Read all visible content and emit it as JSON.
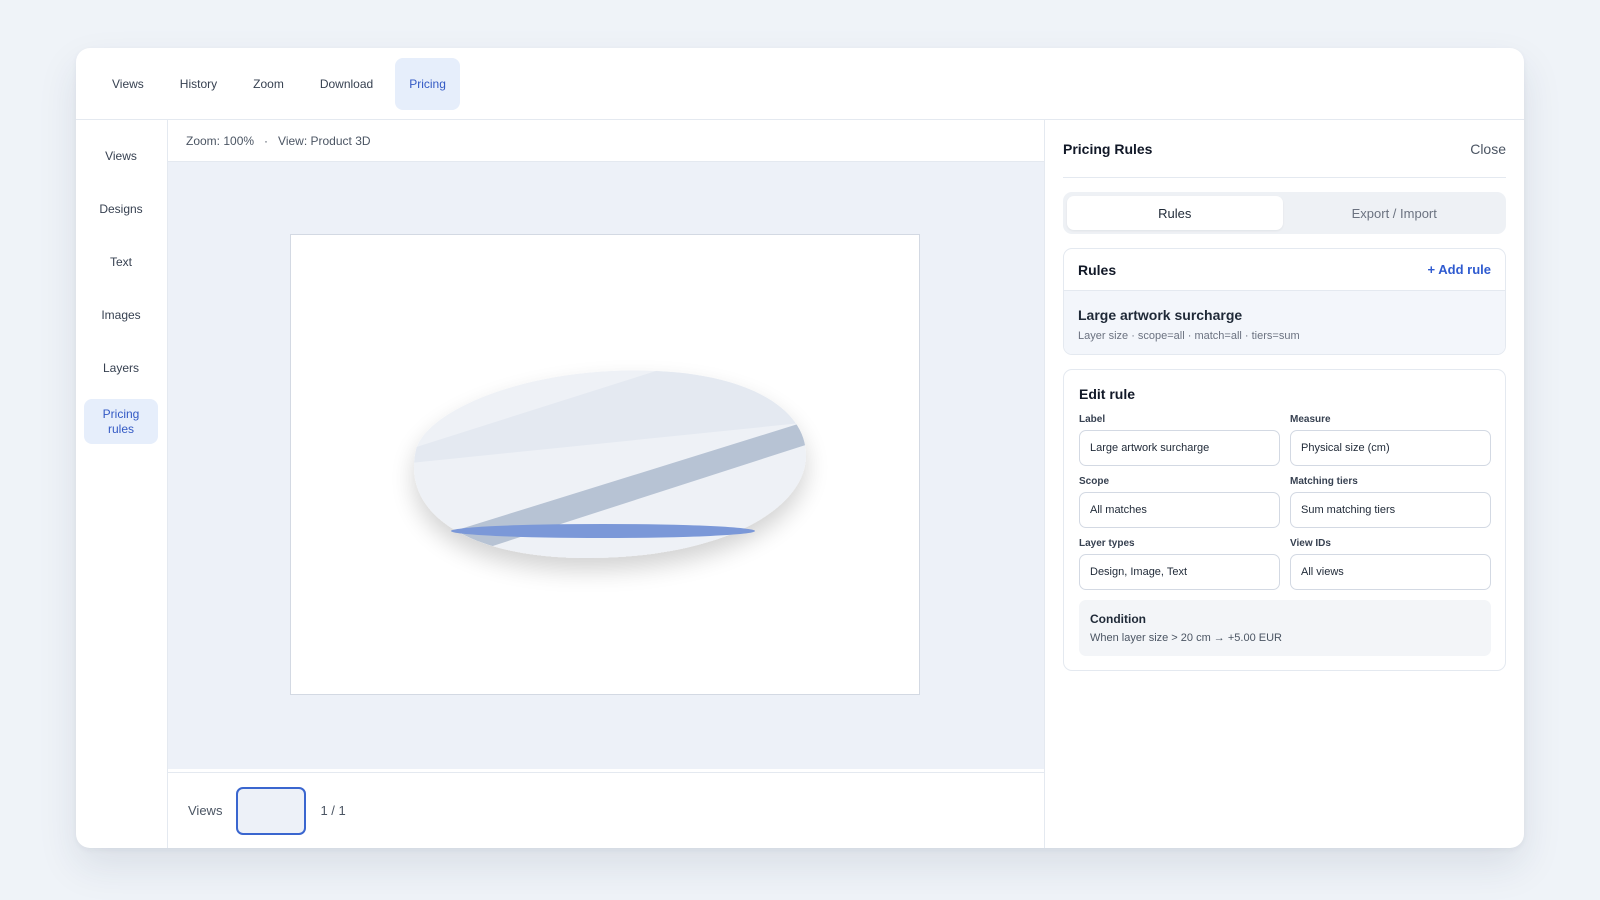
{
  "topbar": {
    "tabs": [
      {
        "label": "Views"
      },
      {
        "label": "History"
      },
      {
        "label": "Zoom"
      },
      {
        "label": "Download"
      },
      {
        "label": "Pricing"
      }
    ],
    "active_tab": "Pricing"
  },
  "sidebar": {
    "items": [
      {
        "label": "Views"
      },
      {
        "label": "Designs"
      },
      {
        "label": "Text"
      },
      {
        "label": "Images"
      },
      {
        "label": "Layers"
      },
      {
        "label": "Pricing rules"
      }
    ],
    "active_item": "Pricing rules"
  },
  "canvas": {
    "zoom_text": "Zoom: 100%",
    "separator": "·",
    "view_text": "View: Product 3D"
  },
  "bottombar": {
    "label": "Views",
    "page_count": "1 / 1"
  },
  "panel": {
    "title": "Pricing Rules",
    "close_label": "Close",
    "segments": [
      {
        "label": "Rules"
      },
      {
        "label": "Export / Import"
      }
    ],
    "active_segment": "Rules",
    "rules": {
      "header": "Rules",
      "add_label": "+ Add rule",
      "items": [
        {
          "name": "Large artwork surcharge",
          "meta": "Layer size · scope=all · match=all · tiers=sum"
        }
      ]
    },
    "edit": {
      "title": "Edit rule",
      "fields": {
        "label": {
          "label": "Label",
          "value": "Large artwork surcharge"
        },
        "measure": {
          "label": "Measure",
          "value": "Physical size (cm)"
        },
        "scope": {
          "label": "Scope",
          "value": "All matches"
        },
        "matching_tiers": {
          "label": "Matching tiers",
          "value": "Sum matching tiers"
        },
        "layer_types": {
          "label": "Layer types",
          "value": "Design, Image, Text"
        },
        "view_ids": {
          "label": "View IDs",
          "value": "All views"
        }
      },
      "condition": {
        "title": "Condition",
        "text": "When layer size > 20 cm → +5.00 EUR"
      }
    }
  },
  "colors": {
    "accent": "#2f5bd0",
    "active_bg": "#e6eefb",
    "canvas_bg": "#edf1f8",
    "product_highlight": "#7b98d8"
  }
}
